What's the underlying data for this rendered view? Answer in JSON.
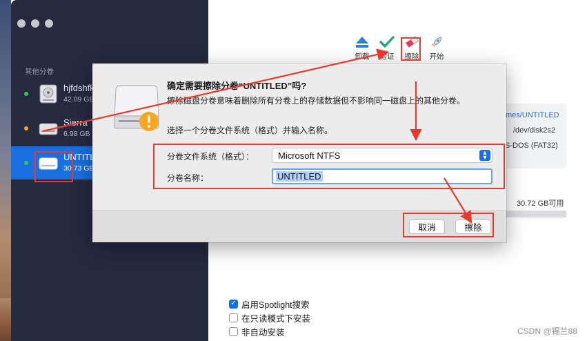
{
  "sidebar": {
    "section_label": "其他分卷",
    "items": [
      {
        "name": "hjfdshfk",
        "size": "42.09 GB",
        "status_color": "#34c759",
        "selected": false
      },
      {
        "name": "Sierra",
        "size": "6.98 GB",
        "status_color": "#f5a623",
        "selected": false
      },
      {
        "name": "UNTITLED",
        "size": "30.73 GB",
        "status_color": "#34c759",
        "selected": true
      }
    ]
  },
  "toolbar": {
    "unmount_label": "卸载",
    "verify_label": "验证",
    "erase_label": "擦除",
    "start_label": "开始"
  },
  "info": {
    "mount_path": "mes/UNTITLED",
    "device": "/dev/disk2s2",
    "format": "S-DOS (FAT32)",
    "available": "30.72 GB可用"
  },
  "options": [
    {
      "label": "启用Spotlight搜索",
      "checked": true
    },
    {
      "label": "在只读模式下安装",
      "checked": false
    },
    {
      "label": "非自动安装",
      "checked": false
    }
  ],
  "dialog": {
    "title": "确定需要擦除分卷“UNTITLED”吗?",
    "message": "擦除磁盘分卷意味着删除所有分卷上的存储数据但不影响同一磁盘上的其他分卷。",
    "instruction": "选择一个分卷文件系统（格式）并输入名称。",
    "format_label": "分卷文件系统（格式）：",
    "format_value": "Microsoft NTFS",
    "name_label": "分卷名称：",
    "name_value": "UNTITLED",
    "cancel_label": "取消",
    "erase_label": "擦除"
  },
  "watermark": "CSDN @锡兰88",
  "colors": {
    "accent": "#1a6fe0",
    "annotation_red": "#e63a2e",
    "sidebar_bg": "#262a3f",
    "warning": "#f5a623"
  }
}
